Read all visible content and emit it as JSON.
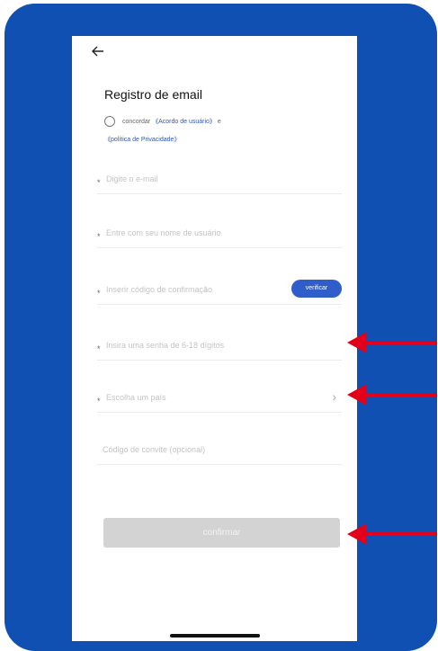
{
  "header": {
    "back_icon": "arrow-left-icon",
    "title": "Registro de email"
  },
  "agreement": {
    "prefix": "concordar",
    "user_agreement": "《Acordo de usuário》",
    "conjunction": "e",
    "privacy_policy": "《política de Privacidade》"
  },
  "fields": {
    "email": {
      "required": "*",
      "placeholder": "Digite o e-mail"
    },
    "username": {
      "required": "*",
      "placeholder": "Entre com seu nome de usuário"
    },
    "code": {
      "required": "*",
      "placeholder": "Inserir código de confirmação"
    },
    "password": {
      "required": "*",
      "placeholder": "Insira uma senha de 6-18 dígitos"
    },
    "country": {
      "required": "*",
      "placeholder": "Escolha um país",
      "chevron": "›"
    },
    "invite": {
      "placeholder": "Código de convite (opcional)"
    }
  },
  "buttons": {
    "verify": "verificar",
    "confirm": "confirmar"
  },
  "colors": {
    "frame": "#1150b3",
    "accent": "#2f5dc9",
    "annotation_arrow": "#e3001b",
    "disabled_button": "#d3d3d3"
  }
}
